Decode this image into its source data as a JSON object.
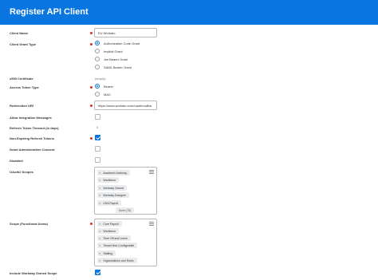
{
  "header": {
    "title": "Register API Client"
  },
  "fields": {
    "client_name": {
      "label": "Client Name",
      "value": "EU Workato"
    },
    "grant_type": {
      "label": "Client Grant Type",
      "options": [
        {
          "label": "Authorization Code Grant",
          "selected": true
        },
        {
          "label": "Implicit Grant",
          "selected": false
        },
        {
          "label": "Jwt Bearer Grant",
          "selected": false
        },
        {
          "label": "SAML Bearer Grant",
          "selected": false
        }
      ]
    },
    "x509": {
      "label": "x509 Certificate",
      "value": "(empty)"
    },
    "access_token_type": {
      "label": "Access Token Type",
      "options": [
        {
          "label": "Bearer",
          "selected": true
        },
        {
          "label": "MAC",
          "selected": false
        }
      ]
    },
    "redirection_uri": {
      "label": "Redirection URI",
      "value": "https://www.workato.com/oauth/callba"
    },
    "allow_integration_messages": {
      "label": "Allow Integration Messages",
      "checked": false
    },
    "refresh_token_timeout": {
      "label": "Refresh Token Timeout (in days)",
      "value": "0"
    },
    "non_expiring_refresh": {
      "label": "Non-Expiring Refresh Tokens",
      "checked": true
    },
    "grant_admin_consent": {
      "label": "Grant Administrative Consent",
      "checked": false
    },
    "disabled": {
      "label": "Disabled",
      "checked": false
    },
    "oauth2_scopes": {
      "label": "OAuth2 Scopes",
      "items": [
        "Academic Advising",
        "Workforce",
        "Workday Owned",
        "Workday Designer",
        "USA Payroll"
      ],
      "more_label": "More (75)"
    },
    "scope_functional": {
      "label": "Scope (Functional Areas)",
      "items": [
        "Core Payroll",
        "Workforce",
        "Time Off and Leave",
        "Tenant Non-Configurable",
        "Staffing",
        "Organizations and Roles"
      ]
    },
    "include_workday_owned": {
      "label": "Include Workday Owned Scope",
      "checked": true
    }
  },
  "colors": {
    "header": "#0875e1",
    "accent": "#0875e1",
    "required": "#de2e21"
  },
  "icons": {
    "remove": "close-icon",
    "list": "list-icon",
    "check": "checkmark-icon"
  }
}
